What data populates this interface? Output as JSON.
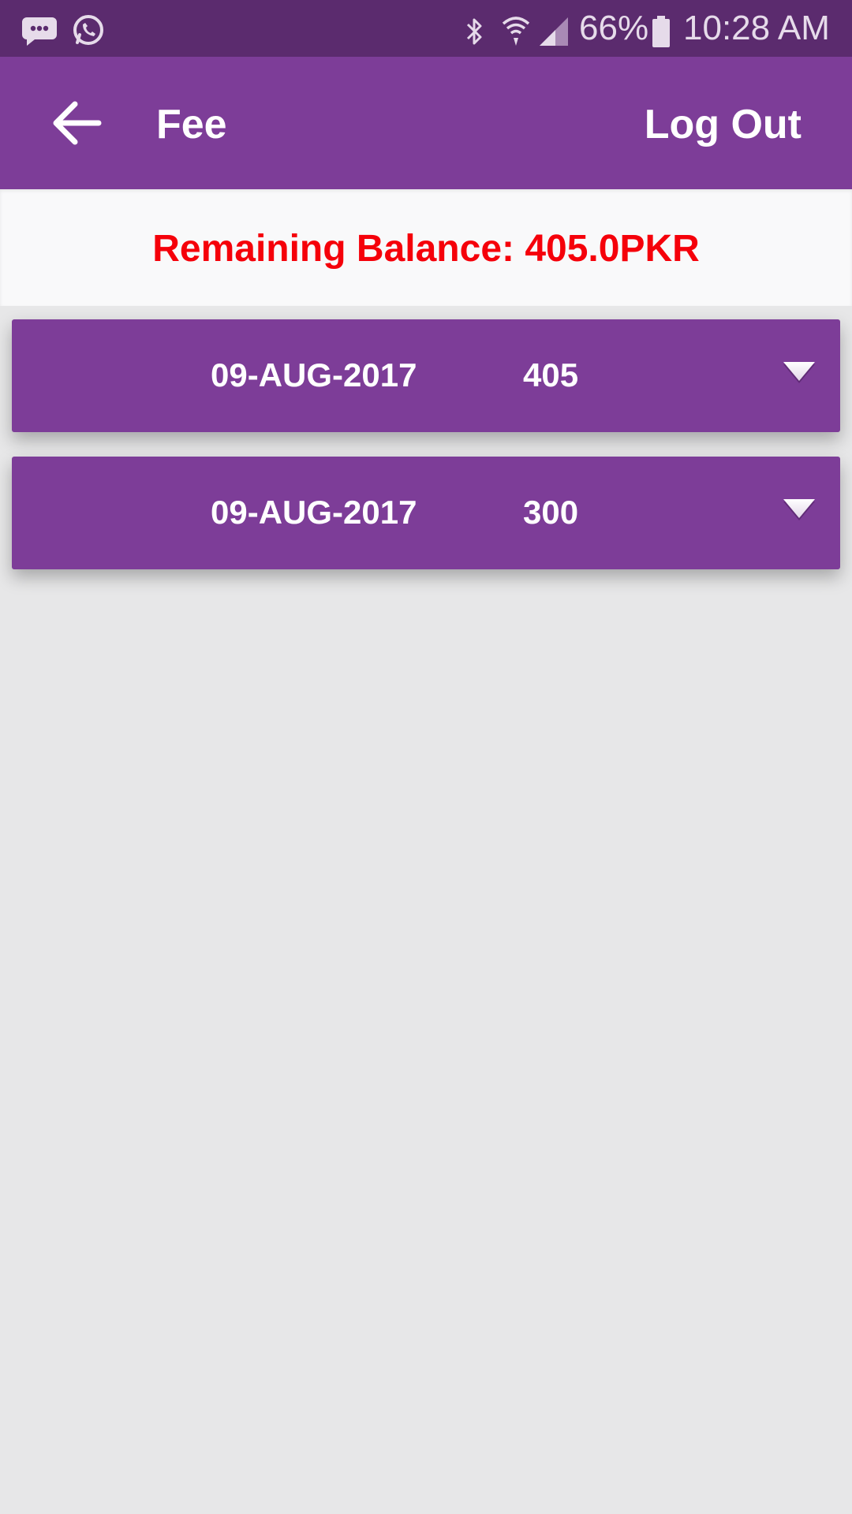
{
  "status_bar": {
    "battery": "66%",
    "time": "10:28 AM",
    "icons": [
      "message-icon",
      "whatsapp-icon",
      "bluetooth-icon",
      "wifi-icon",
      "signal-icon",
      "battery-icon"
    ]
  },
  "app_bar": {
    "title": "Fee",
    "logout_label": "Log Out",
    "back_icon": "arrow-left-icon"
  },
  "balance": {
    "text": "Remaining Balance: 405.0PKR",
    "color": "#f5000a"
  },
  "fees": [
    {
      "date": "09-AUG-2017",
      "amount": "405",
      "icon": "chevron-down-icon"
    },
    {
      "date": "09-AUG-2017",
      "amount": "300",
      "icon": "chevron-down-icon"
    }
  ],
  "colors": {
    "primary": "#7d3d98",
    "status_bar": "#5b2b6e",
    "background": "#e7e7e8",
    "text_light": "#ffffff"
  }
}
